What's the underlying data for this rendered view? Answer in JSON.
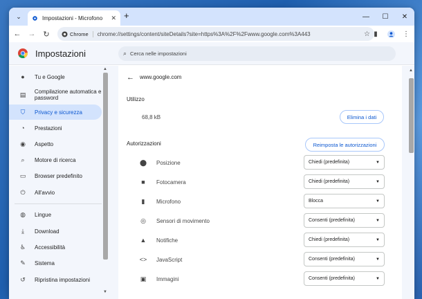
{
  "browser": {
    "tab_title": "Impostazioni - Microfono",
    "chip_label": "Chrome",
    "url": "chrome://settings/content/siteDetails?site=https%3A%2F%2Fwww.google.com%3A443"
  },
  "header": {
    "title": "Impostazioni",
    "search_placeholder": "Cerca nelle impostazioni"
  },
  "sidebar": {
    "items": [
      {
        "label": "Tu e Google",
        "icon": "person-icon"
      },
      {
        "label": "Compilazione automatica e password",
        "icon": "clipboard-icon"
      },
      {
        "label": "Privacy e sicurezza",
        "icon": "shield-icon",
        "active": true
      },
      {
        "label": "Prestazioni",
        "icon": "gauge-icon"
      },
      {
        "label": "Aspetto",
        "icon": "palette-icon"
      },
      {
        "label": "Motore di ricerca",
        "icon": "search-icon"
      },
      {
        "label": "Browser predefinito",
        "icon": "browser-icon"
      },
      {
        "label": "All'avvio",
        "icon": "power-icon"
      },
      {
        "label": "Lingue",
        "icon": "globe-icon"
      },
      {
        "label": "Download",
        "icon": "download-icon"
      },
      {
        "label": "Accessibilità",
        "icon": "accessibility-icon"
      },
      {
        "label": "Sistema",
        "icon": "wrench-icon"
      },
      {
        "label": "Ripristina impostazioni",
        "icon": "reset-icon"
      }
    ]
  },
  "site": {
    "name": "www.google.com",
    "usage_heading": "Utilizzo",
    "usage_value": "68,8 kB",
    "clear_button": "Elimina i dati",
    "permissions_heading": "Autorizzazioni",
    "reset_button": "Reimposta le autorizzazioni",
    "permissions": [
      {
        "label": "Posizione",
        "icon": "location-icon",
        "value": "Chiedi (predefinita)"
      },
      {
        "label": "Fotocamera",
        "icon": "camera-icon",
        "value": "Chiedi (predefinita)"
      },
      {
        "label": "Microfono",
        "icon": "microphone-icon",
        "value": "Blocca"
      },
      {
        "label": "Sensori di movimento",
        "icon": "motion-sensor-icon",
        "value": "Consenti (predefinita)"
      },
      {
        "label": "Notifiche",
        "icon": "bell-icon",
        "value": "Chiedi (predefinita)"
      },
      {
        "label": "JavaScript",
        "icon": "code-icon",
        "value": "Consenti (predefinita)"
      },
      {
        "label": "Immagini",
        "icon": "image-icon",
        "value": "Consenti (predefinita)"
      }
    ]
  },
  "colors": {
    "accent": "#0b57d0",
    "tabstrip": "#d3e3fd",
    "active_nav": "#d3e3fd",
    "page_bg": "#f3f6fc"
  }
}
